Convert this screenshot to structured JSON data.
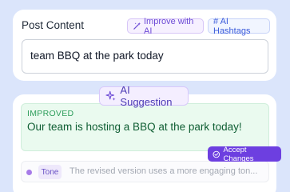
{
  "post": {
    "title": "Post Content",
    "improve_label": "Improve with AI",
    "hashtags_label": "# AI Hashtags",
    "input_value": "team BBQ at the park today"
  },
  "suggestion": {
    "badge_label": "AI Suggestion",
    "improved_label": "IMPROVED",
    "improved_text": "Our team is hosting a BBQ at the park today!",
    "accept_label": "Accept Changes",
    "tone_tag": "Tone",
    "tone_text": "The revised version uses a more engaging ton..."
  },
  "icons": {
    "improve": "magic-wand-icon",
    "sparkle": "sparkle-icon",
    "accept": "check-circle-icon",
    "tone_dot": "dot-icon"
  },
  "colors": {
    "accent": "#6d3fe0",
    "success_text": "#0f5e33",
    "background": "#dbe5fb"
  }
}
